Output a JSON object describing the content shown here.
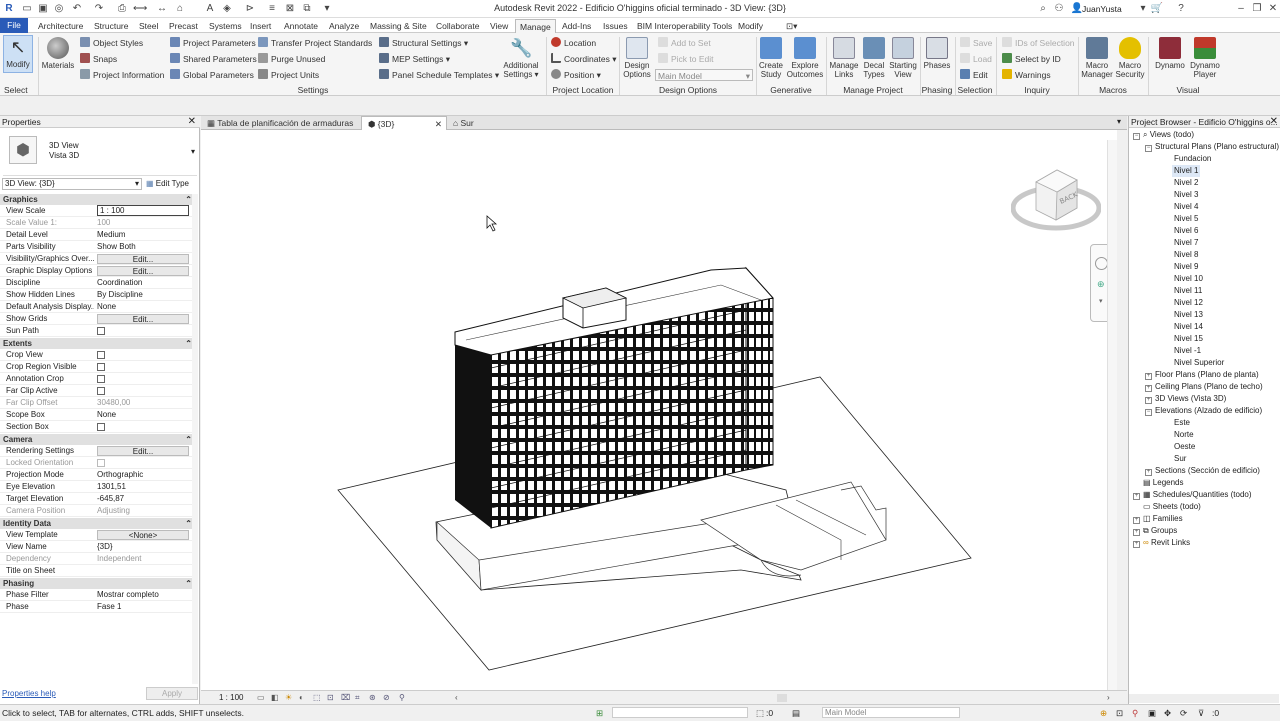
{
  "app": {
    "title": "Autodesk Revit 2022 - Edificio O'higgins oficial terminado - 3D View: {3D}"
  },
  "user": {
    "name": "JuanYusta"
  },
  "tabs": [
    "File",
    "Architecture",
    "Structure",
    "Steel",
    "Precast",
    "Systems",
    "Insert",
    "Annotate",
    "Analyze",
    "Massing & Site",
    "Collaborate",
    "View",
    "Manage",
    "Add-Ins",
    "Issues",
    "BIM Interoperability Tools",
    "Modify"
  ],
  "ribbon": {
    "select": {
      "modify": "Modify",
      "label": "Select"
    },
    "settings": {
      "materials": "Materials",
      "object_styles": "Object Styles",
      "snaps": "Snaps",
      "project_information": "Project Information",
      "project_parameters": "Project Parameters",
      "shared_parameters": "Shared Parameters",
      "global_parameters": "Global Parameters",
      "transfer_standards": "Transfer Project Standards",
      "purge_unused": "Purge Unused",
      "project_units": "Project Units",
      "structural_settings": "Structural Settings",
      "mep_settings": "MEP Settings",
      "panel_schedule_templates": "Panel Schedule Templates",
      "additional_settings_1": "Additional",
      "additional_settings_2": "Settings",
      "label": "Settings"
    },
    "project_location": {
      "location": "Location",
      "coordinates": "Coordinates",
      "position": "Position",
      "label": "Project Location"
    },
    "design_options": {
      "design_1": "Design",
      "design_2": "Options",
      "add_to_set": "Add to Set",
      "pick_to_edit": "Pick to Edit",
      "main_model": "Main Model",
      "label": "Design Options"
    },
    "generative": {
      "create_1": "Create",
      "create_2": "Study",
      "explore_1": "Explore",
      "explore_2": "Outcomes",
      "label": "Generative Design"
    },
    "manage_project": {
      "manage_links_1": "Manage",
      "manage_links_2": "Links",
      "decal_1": "Decal",
      "decal_2": "Types",
      "starting_1": "Starting",
      "starting_2": "View",
      "label": "Manage Project"
    },
    "phasing": {
      "phases": "Phases",
      "label": "Phasing"
    },
    "selection": {
      "save": "Save",
      "load": "Load",
      "edit": "Edit",
      "label": "Selection"
    },
    "inquiry": {
      "ids": "IDs of Selection",
      "select_by_id": "Select by ID",
      "warnings": "Warnings",
      "label": "Inquiry"
    },
    "macros": {
      "manager_1": "Macro",
      "manager_2": "Manager",
      "security_1": "Macro",
      "security_2": "Security",
      "label": "Macros"
    },
    "visual": {
      "dynamo": "Dynamo",
      "player_1": "Dynamo",
      "player_2": "Player",
      "label": "Visual Programming"
    }
  },
  "properties": {
    "title": "Properties",
    "type_name_1": "3D View",
    "type_name_2": "Vista 3D",
    "selector": "3D View: {3D}",
    "edit_type": "Edit Type",
    "groups": {
      "graphics": "Graphics",
      "extents": "Extents",
      "camera": "Camera",
      "identity": "Identity Data",
      "phasing": "Phasing"
    },
    "rows": {
      "view_scale": [
        "View Scale",
        "1 : 100"
      ],
      "scale_value": [
        "Scale Value    1:",
        "100"
      ],
      "detail_level": [
        "Detail Level",
        "Medium"
      ],
      "parts_visibility": [
        "Parts Visibility",
        "Show Both"
      ],
      "vg_overrides": [
        "Visibility/Graphics Over...",
        "Edit..."
      ],
      "graphic_display": [
        "Graphic Display Options",
        "Edit..."
      ],
      "discipline": [
        "Discipline",
        "Coordination"
      ],
      "hidden_lines": [
        "Show Hidden Lines",
        "By Discipline"
      ],
      "analysis_display": [
        "Default Analysis Display...",
        "None"
      ],
      "show_grids": [
        "Show Grids",
        "Edit..."
      ],
      "sun_path": [
        "Sun Path",
        ""
      ],
      "crop_view": [
        "Crop View",
        ""
      ],
      "crop_region": [
        "Crop Region Visible",
        ""
      ],
      "annotation_crop": [
        "Annotation Crop",
        ""
      ],
      "far_clip": [
        "Far Clip Active",
        ""
      ],
      "far_clip_offset": [
        "Far Clip Offset",
        "30480,00"
      ],
      "scope_box": [
        "Scope Box",
        "None"
      ],
      "section_box": [
        "Section Box",
        ""
      ],
      "rendering": [
        "Rendering Settings",
        "Edit..."
      ],
      "locked_orientation": [
        "Locked Orientation",
        ""
      ],
      "projection_mode": [
        "Projection Mode",
        "Orthographic"
      ],
      "eye_elevation": [
        "Eye Elevation",
        "1301,51"
      ],
      "target_elevation": [
        "Target Elevation",
        "-645,87"
      ],
      "camera_position": [
        "Camera Position",
        "Adjusting"
      ],
      "view_template": [
        "View Template",
        "<None>"
      ],
      "view_name": [
        "View Name",
        "{3D}"
      ],
      "dependency": [
        "Dependency",
        "Independent"
      ],
      "title_on_sheet": [
        "Title on Sheet",
        ""
      ],
      "phase_filter": [
        "Phase Filter",
        "Mostrar completo"
      ],
      "phase": [
        "Phase",
        "Fase 1"
      ]
    },
    "help": "Properties help",
    "apply": "Apply"
  },
  "view_tabs": [
    "Tabla de planificación de armaduras",
    "{3D}",
    "Sur"
  ],
  "viewcube": {
    "face": "BACK"
  },
  "view_bar": {
    "scale": "1 : 100"
  },
  "browser": {
    "title": "Project Browser - Edificio O'higgins o...",
    "views": "Views (todo)",
    "structural_plans": "Structural Plans (Plano estructural)",
    "levels": [
      "Fundacion",
      "Nivel 1",
      "Nivel 2",
      "Nivel 3",
      "Nivel 4",
      "Nivel 5",
      "Nivel 6",
      "Nivel 7",
      "Nivel 8",
      "Nivel 9",
      "Nivel 10",
      "Nivel 11",
      "Nivel 12",
      "Nivel 13",
      "Nivel 14",
      "Nivel 15",
      "Nivel -1",
      "Nivel Superior"
    ],
    "floor_plans": "Floor Plans (Plano de planta)",
    "ceiling_plans": "Ceiling Plans (Plano de techo)",
    "views_3d": "3D Views (Vista 3D)",
    "elevations": "Elevations (Alzado de edificio)",
    "elevation_items": [
      "Este",
      "Norte",
      "Oeste",
      "Sur"
    ],
    "sections": "Sections (Sección de edificio)",
    "legends": "Legends",
    "schedules": "Schedules/Quantities (todo)",
    "sheets": "Sheets (todo)",
    "families": "Families",
    "groups": "Groups",
    "revit_links": "Revit Links"
  },
  "status": {
    "hint": "Click to select, TAB for alternates, CTRL adds, SHIFT unselects.",
    "count": ":0",
    "model": "Main Model",
    "filter_count": ":0"
  }
}
